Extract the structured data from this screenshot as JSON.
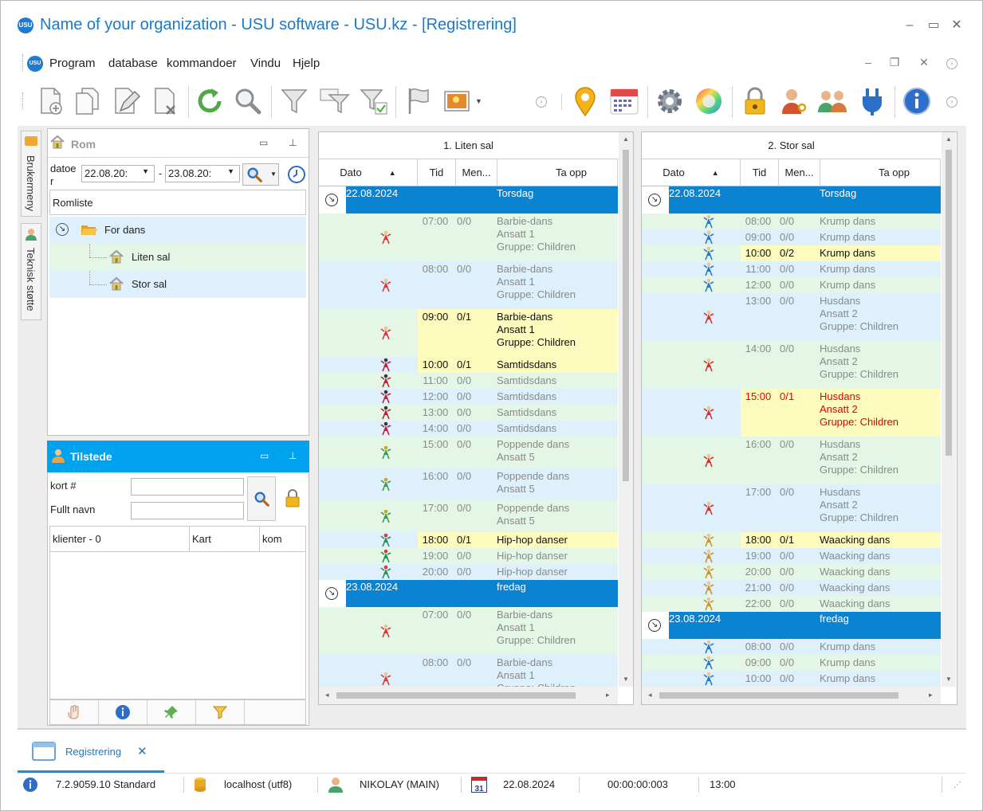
{
  "window": {
    "title": "Name of your organization - USU software - USU.kz - [Registrering]",
    "logo_text": "USU"
  },
  "menu": {
    "items": [
      "Program",
      "database",
      "kommandoer",
      "Vindu",
      "Hjelp"
    ]
  },
  "side_tabs": {
    "user_menu": "Brukermeny",
    "support": "Teknisk støtte"
  },
  "rooms_panel": {
    "title": "Rom",
    "date_label": "datoe r",
    "date_from": "22.08.20:",
    "date_to": "23.08.20:",
    "date_sep": "-",
    "list_header": "Romliste",
    "group": "For dans",
    "rooms": [
      "Liten sal",
      "Stor sal"
    ]
  },
  "present_panel": {
    "title": "Tilstede",
    "card_label": "kort #",
    "name_label": "Fullt navn",
    "card_value": "",
    "name_value": "",
    "columns": [
      "klienter - 0",
      "Kart",
      "kom"
    ]
  },
  "grid_columns": [
    "Dato",
    "Tid",
    "Men...",
    "Ta opp"
  ],
  "schedules": [
    {
      "hall": "1. Liten sal",
      "days": [
        {
          "date": "22.08.2024",
          "weekday": "Torsdag",
          "rows": [
            {
              "time": "07:00",
              "count": "0/0",
              "lines": [
                "Barbie-dans",
                "Ansatt 1",
                "Gruppe: Children"
              ],
              "state": "dim",
              "icon": "barbie"
            },
            {
              "time": "08:00",
              "count": "0/0",
              "lines": [
                "Barbie-dans",
                "Ansatt 1",
                "Gruppe: Children"
              ],
              "state": "dim",
              "icon": "barbie"
            },
            {
              "time": "09:00",
              "count": "0/1",
              "lines": [
                "Barbie-dans",
                "Ansatt 1",
                "Gruppe: Children"
              ],
              "state": "hl",
              "icon": "barbie"
            },
            {
              "time": "10:00",
              "count": "0/1",
              "lines": [
                "Samtidsdans"
              ],
              "state": "hl",
              "icon": "modern"
            },
            {
              "time": "11:00",
              "count": "0/0",
              "lines": [
                "Samtidsdans"
              ],
              "state": "dim",
              "icon": "modern"
            },
            {
              "time": "12:00",
              "count": "0/0",
              "lines": [
                "Samtidsdans"
              ],
              "state": "dim",
              "icon": "modern"
            },
            {
              "time": "13:00",
              "count": "0/0",
              "lines": [
                "Samtidsdans"
              ],
              "state": "dim",
              "icon": "modern"
            },
            {
              "time": "14:00",
              "count": "0/0",
              "lines": [
                "Samtidsdans"
              ],
              "state": "dim",
              "icon": "modern"
            },
            {
              "time": "15:00",
              "count": "0/0",
              "lines": [
                "Poppende dans",
                "Ansatt 5"
              ],
              "state": "dim",
              "icon": "popping"
            },
            {
              "time": "16:00",
              "count": "0/0",
              "lines": [
                "Poppende dans",
                "Ansatt 5"
              ],
              "state": "dim",
              "icon": "popping"
            },
            {
              "time": "17:00",
              "count": "0/0",
              "lines": [
                "Poppende dans",
                "Ansatt 5"
              ],
              "state": "dim",
              "icon": "popping"
            },
            {
              "time": "18:00",
              "count": "0/1",
              "lines": [
                "Hip-hop danser"
              ],
              "state": "hl",
              "icon": "hiphop"
            },
            {
              "time": "19:00",
              "count": "0/0",
              "lines": [
                "Hip-hop danser"
              ],
              "state": "dim",
              "icon": "hiphop"
            },
            {
              "time": "20:00",
              "count": "0/0",
              "lines": [
                "Hip-hop danser"
              ],
              "state": "dim",
              "icon": "hiphop"
            }
          ]
        },
        {
          "date": "23.08.2024",
          "weekday": "fredag",
          "rows": [
            {
              "time": "07:00",
              "count": "0/0",
              "lines": [
                "Barbie-dans",
                "Ansatt 1",
                "Gruppe: Children"
              ],
              "state": "dim",
              "icon": "barbie"
            },
            {
              "time": "08:00",
              "count": "0/0",
              "lines": [
                "Barbie-dans",
                "Ansatt 1",
                "Gruppe: Children"
              ],
              "state": "dim",
              "icon": "barbie"
            }
          ]
        }
      ]
    },
    {
      "hall": "2. Stor sal",
      "days": [
        {
          "date": "22.08.2024",
          "weekday": "Torsdag",
          "rows": [
            {
              "time": "08:00",
              "count": "0/0",
              "lines": [
                "Krump dans"
              ],
              "state": "dim",
              "icon": "krump"
            },
            {
              "time": "09:00",
              "count": "0/0",
              "lines": [
                "Krump dans"
              ],
              "state": "dim",
              "icon": "krump"
            },
            {
              "time": "10:00",
              "count": "0/2",
              "lines": [
                "Krump dans"
              ],
              "state": "hl",
              "icon": "krump"
            },
            {
              "time": "11:00",
              "count": "0/0",
              "lines": [
                "Krump dans"
              ],
              "state": "dim",
              "icon": "krump"
            },
            {
              "time": "12:00",
              "count": "0/0",
              "lines": [
                "Krump dans"
              ],
              "state": "dim",
              "icon": "krump"
            },
            {
              "time": "13:00",
              "count": "0/0",
              "lines": [
                "Husdans",
                "Ansatt 2",
                "Gruppe: Children"
              ],
              "state": "dim",
              "icon": "house"
            },
            {
              "time": "14:00",
              "count": "0/0",
              "lines": [
                "Husdans",
                "Ansatt 2",
                "Gruppe: Children"
              ],
              "state": "dim",
              "icon": "house"
            },
            {
              "time": "15:00",
              "count": "0/1",
              "lines": [
                "Husdans",
                "Ansatt 2",
                "Gruppe: Children"
              ],
              "state": "red",
              "icon": "house"
            },
            {
              "time": "16:00",
              "count": "0/0",
              "lines": [
                "Husdans",
                "Ansatt 2",
                "Gruppe: Children"
              ],
              "state": "dim",
              "icon": "house"
            },
            {
              "time": "17:00",
              "count": "0/0",
              "lines": [
                "Husdans",
                "Ansatt 2",
                "Gruppe: Children"
              ],
              "state": "dim",
              "icon": "house"
            },
            {
              "time": "18:00",
              "count": "0/1",
              "lines": [
                "Waacking dans"
              ],
              "state": "hl",
              "icon": "waacking"
            },
            {
              "time": "19:00",
              "count": "0/0",
              "lines": [
                "Waacking dans"
              ],
              "state": "dim",
              "icon": "waacking"
            },
            {
              "time": "20:00",
              "count": "0/0",
              "lines": [
                "Waacking dans"
              ],
              "state": "dim",
              "icon": "waacking"
            },
            {
              "time": "21:00",
              "count": "0/0",
              "lines": [
                "Waacking dans"
              ],
              "state": "dim",
              "icon": "waacking"
            },
            {
              "time": "22:00",
              "count": "0/0",
              "lines": [
                "Waacking dans"
              ],
              "state": "dim",
              "icon": "waacking"
            }
          ]
        },
        {
          "date": "23.08.2024",
          "weekday": "fredag",
          "rows": [
            {
              "time": "08:00",
              "count": "0/0",
              "lines": [
                "Krump dans"
              ],
              "state": "dim",
              "icon": "krump"
            },
            {
              "time": "09:00",
              "count": "0/0",
              "lines": [
                "Krump dans"
              ],
              "state": "dim",
              "icon": "krump"
            },
            {
              "time": "10:00",
              "count": "0/0",
              "lines": [
                "Krump dans"
              ],
              "state": "dim",
              "icon": "krump"
            }
          ]
        }
      ]
    }
  ],
  "doc_tab": {
    "label": "Registrering",
    "close": "✕"
  },
  "status": {
    "version": "7.2.9059.10 Standard",
    "db": "localhost (utf8)",
    "user": "NIKOLAY (MAIN)",
    "calendar_day": "31",
    "date": "22.08.2024",
    "timer": "00:00:00:003",
    "time": "13:00"
  },
  "colors": {
    "accent": "#0a84d2",
    "panel_header": "#00a2ed",
    "row_green": "#e4f7e6",
    "row_blue": "#ddf0fb",
    "row_yellow": "#fdfbbd",
    "text_dim": "#8a8a8a",
    "text_red": "#e40000"
  }
}
